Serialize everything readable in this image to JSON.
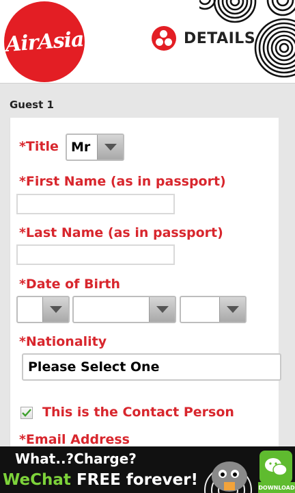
{
  "header": {
    "logo_text": "AirAsia",
    "step_title": "DETAILS",
    "icons": {
      "logo": "airasia-logo",
      "step": "people-icon",
      "decor": "concentric-circles"
    }
  },
  "guest": {
    "title": "Guest 1",
    "fields": {
      "title_label": "*Title",
      "title_value": "Mr",
      "first_name_label": "*First Name (as in passport)",
      "first_name_value": "",
      "last_name_label": "*Last Name (as in passport)",
      "last_name_value": "",
      "dob_label": "*Date of Birth",
      "dob_day": "",
      "dob_month": "",
      "dob_year": "",
      "nationality_label": "*Nationality",
      "nationality_value": "Please Select One",
      "contact_label": "This is the Contact Person",
      "contact_checked": true,
      "email_label": "*Email Address"
    }
  },
  "ad": {
    "line1": "What..?Charge?",
    "line2_a": "WeChat ",
    "line2_b": "FREE forever!",
    "download": "DOWNLOAD",
    "icons": {
      "mascot": "mascot-character",
      "app": "wechat-icon"
    }
  },
  "colors": {
    "brand_red": "#e31e24",
    "label_red": "#d8262d",
    "wechat_green": "#5fbb2f"
  }
}
